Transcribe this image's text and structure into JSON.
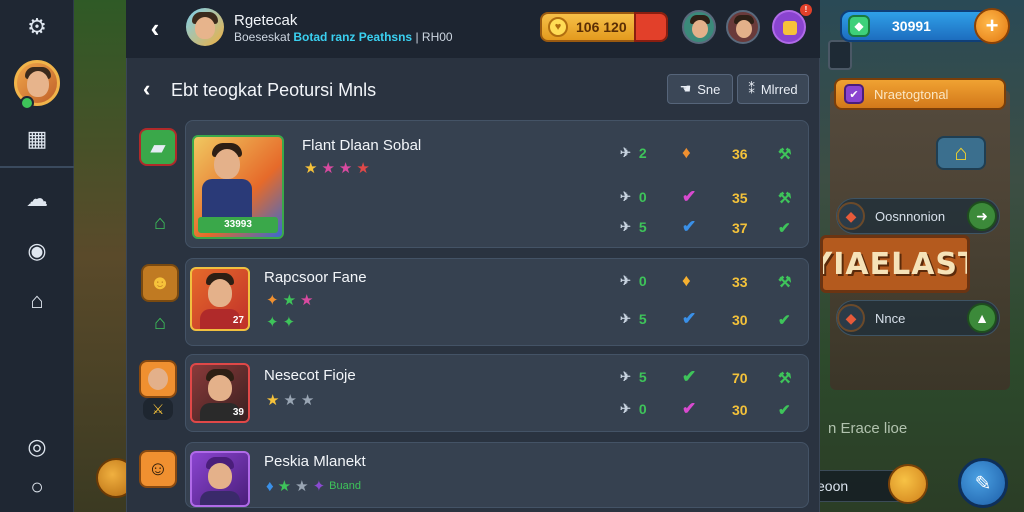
{
  "topbar": {
    "title": "Rgetecak",
    "subtitle_a": "Boeseskat",
    "subtitle_b": "Botad ranz",
    "subtitle_c": "Peathsns",
    "subtitle_d": "| RH00",
    "coins": "106 120"
  },
  "gems": {
    "value": "30991"
  },
  "panel": {
    "title": "Ebt teogkat Peotursi Mnls",
    "btn_a": "Sne",
    "btn_b": "Mlrred"
  },
  "rows": [
    {
      "name": "Flant Dlaan Sobal",
      "tag": "33993",
      "stars": [
        "★",
        "★",
        "★",
        "★"
      ],
      "star_colors": [
        "#f6c23a",
        "#d94aa0",
        "#d94aa0",
        "#e04848"
      ],
      "lines": [
        {
          "count": "2",
          "mid": "♦",
          "mid_color": "#f09030",
          "val": "36",
          "end": "⚒",
          "end_color": "#3ec45a"
        },
        {
          "count": "0",
          "mid": "✔",
          "mid_color": "#d94ad0",
          "val": "35",
          "end": "⚒",
          "end_color": "#3ec45a"
        },
        {
          "count": "5",
          "mid": "✔",
          "mid_color": "#3a90e8",
          "val": "37",
          "end": "✔",
          "end_color": "#3ec45a"
        }
      ]
    },
    {
      "name": "Rapcsoor Fane",
      "tag": "27",
      "stars": [
        "✦",
        "★",
        "★",
        "✦",
        "✦"
      ],
      "star_colors": [
        "#f09030",
        "#3ec45a",
        "#d94aa0",
        "#3ec45a",
        "#3ec45a"
      ],
      "lines": [
        {
          "count": "0",
          "mid": "♦",
          "mid_color": "#f6b030",
          "val": "33",
          "end": "⚒",
          "end_color": "#3ec45a"
        },
        {
          "count": "5",
          "mid": "✔",
          "mid_color": "#3a90e8",
          "val": "30",
          "end": "✔",
          "end_color": "#3ec45a"
        }
      ]
    },
    {
      "name": "Nesecot Fioje",
      "tag": "39",
      "stars": [
        "★",
        "★",
        "★"
      ],
      "star_colors": [
        "#f6c23a",
        "#9aa6b4",
        "#9aa6b4"
      ],
      "lines": [
        {
          "count": "5",
          "mid": "✔",
          "mid_color": "#3ec45a",
          "val": "70",
          "end": "⚒",
          "end_color": "#3ec45a"
        },
        {
          "count": "0",
          "mid": "✔",
          "mid_color": "#d94ad0",
          "val": "30",
          "end": "✔",
          "end_color": "#3ec45a"
        }
      ]
    },
    {
      "name": "Peskia Mlanekt",
      "tag": "",
      "stars": [
        "♦",
        "★",
        "★",
        "✦"
      ],
      "star_colors": [
        "#3a90e8",
        "#3ec45a",
        "#9aa6b4",
        "#8a4ad0"
      ],
      "extra": "Buand",
      "lines": []
    }
  ],
  "right": {
    "orange_btn": "Nraetogtonal",
    "row1": "Oosnnonion",
    "row2": "Nnce",
    "sign": "YIAELAST",
    "bg_text": "n Erace lioe",
    "bottom_pill": "eoon"
  }
}
